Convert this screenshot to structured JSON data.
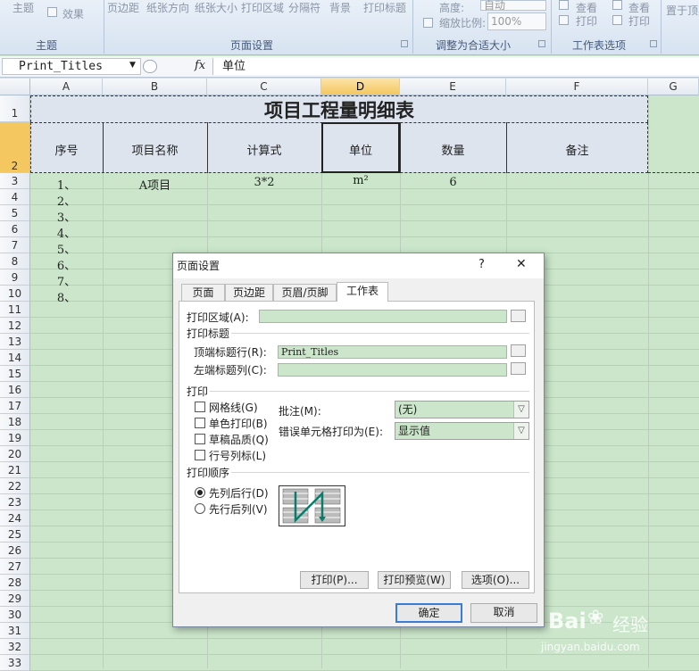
{
  "ribbon": {
    "items": {
      "theme": "主题",
      "effect": "效果",
      "margins": "页边距",
      "orientation": "纸张方向",
      "size": "纸张大小",
      "print_area": "打印区域",
      "breaks": "分隔符",
      "background": "背景",
      "print_titles": "打印标题",
      "height": "高度:",
      "height_val": "自动",
      "scale": "缩放比例:",
      "scale_val": "100%",
      "view": "查看",
      "print": "打印",
      "view2": "查看",
      "print2": "打印",
      "bring": "置于顶"
    },
    "groups": {
      "theme": "主题",
      "page_setup": "页面设置",
      "scale_to_fit": "调整为合适大小",
      "sheet_options": "工作表选项"
    }
  },
  "formula_bar": {
    "name_box": "Print_Titles",
    "fx": "fx",
    "value": "单位"
  },
  "grid": {
    "columns": [
      "A",
      "B",
      "C",
      "D",
      "E",
      "F",
      "G"
    ],
    "rows": [
      "1",
      "2",
      "3",
      "4",
      "5",
      "6",
      "7",
      "8",
      "9",
      "10",
      "11",
      "12",
      "13",
      "14",
      "15",
      "16",
      "17",
      "18",
      "19",
      "20",
      "21",
      "22",
      "23",
      "24",
      "25",
      "26",
      "27",
      "28",
      "29",
      "30",
      "31",
      "32",
      "33"
    ],
    "title": "项目工程量明细表",
    "headers": {
      "a": "序号",
      "b": "项目名称",
      "c": "计算式",
      "d": "单位",
      "e": "数量",
      "f": "备注"
    },
    "row3": {
      "a": "1、",
      "b": "A项目",
      "c": "3*2",
      "d": "m²",
      "e": "6"
    },
    "seq": [
      "2、",
      "3、",
      "4、",
      "5、",
      "6、",
      "7、",
      "8、"
    ]
  },
  "dialog": {
    "title": "页面设置",
    "help": "?",
    "close": "✕",
    "tabs": [
      "页面",
      "页边距",
      "页眉/页脚",
      "工作表"
    ],
    "print_area_label": "打印区域(A):",
    "print_titles_section": "打印标题",
    "top_rows_label": "顶端标题行(R):",
    "top_rows_value": "Print_Titles",
    "left_cols_label": "左端标题列(C):",
    "print_section": "打印",
    "checks": [
      "网格线(G)",
      "单色打印(B)",
      "草稿品质(Q)",
      "行号列标(L)"
    ],
    "comments_label": "批注(M):",
    "comments_value": "(无)",
    "errors_label": "错误单元格打印为(E):",
    "errors_value": "显示值",
    "order_section": "打印顺序",
    "order_options": [
      "先列后行(D)",
      "先行后列(V)"
    ],
    "buttons": {
      "print": "打印(P)...",
      "preview": "打印预览(W)",
      "options": "选项(O)...",
      "ok": "确定",
      "cancel": "取消"
    }
  },
  "watermark": {
    "brand": "Bai",
    "brand2": "经验",
    "url": "jingyan.baidu.com"
  }
}
